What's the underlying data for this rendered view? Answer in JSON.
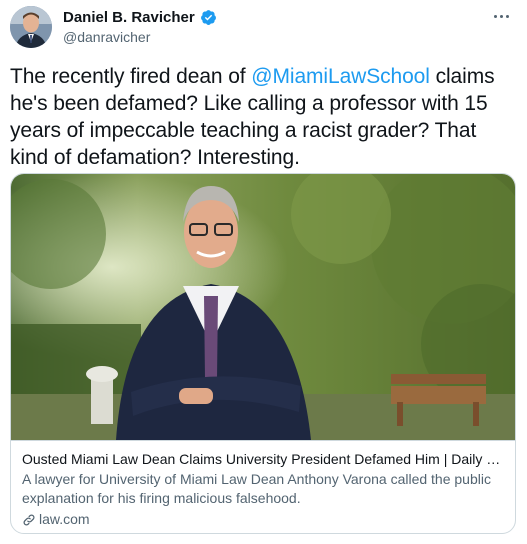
{
  "author": {
    "display_name": "Daniel B. Ravicher",
    "handle": "@danravicher",
    "verified": true,
    "verified_color": "#1d9bf0"
  },
  "tweet": {
    "text_before": "The recently fired dean of ",
    "mention": "@MiamiLawSchool",
    "text_after": " claims he's been defamed? Like calling a professor with 15 years of impeccable teaching a racist grader? That kind of defamation? Interesting."
  },
  "card": {
    "title": "Ousted Miami Law Dean Claims University President Defamed Him | Daily Bu...",
    "description": "A lawyer for University of Miami Law Dean Anthony Varona called the public explanation for his firing malicious falsehood.",
    "domain": "law.com"
  },
  "icons": {
    "verified": "verified-badge-icon",
    "more": "more-horizontal-icon",
    "link": "link-icon"
  },
  "colors": {
    "link_blue": "#1d9bf0",
    "secondary_text": "#536471",
    "border": "#cfd9de"
  }
}
